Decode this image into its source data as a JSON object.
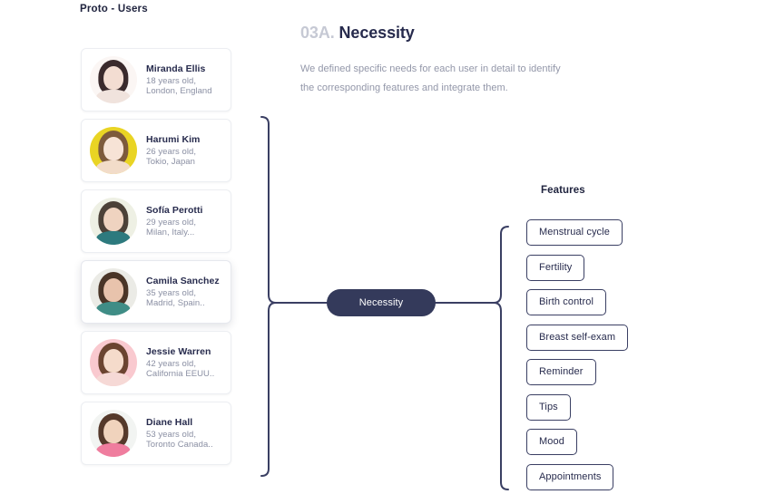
{
  "page": {
    "title": "Proto - Users"
  },
  "section": {
    "number": "03A.",
    "name": "Necessity",
    "description": "We defined specific needs for each user in detail to identify the corresponding features and integrate them."
  },
  "users": [
    {
      "name": "Miranda Ellis",
      "age": "18 years old,",
      "place": "London, England",
      "avatar_bg": "#fbf6f4",
      "hair": "#3a2a2c",
      "skin": "#f3ddd2",
      "body": "#f0e3dd",
      "elevated": false
    },
    {
      "name": "Harumi Kim",
      "age": "26 years old,",
      "place": "Tokio, Japan",
      "avatar_bg": "#e9d424",
      "hair": "#7d5a3c",
      "skin": "#f7e3d6",
      "body": "#f2dcc9",
      "elevated": false
    },
    {
      "name": "Sofía Perotti",
      "age": "29 years old,",
      "place": "Milan, Italy...",
      "avatar_bg": "#eef0e4",
      "hair": "#4c4138",
      "skin": "#efd3c0",
      "body": "#2d7a7e",
      "elevated": false
    },
    {
      "name": "Camila Sanchez",
      "age": "35 years old,",
      "place": "Madrid, Spain..",
      "avatar_bg": "#ebebe6",
      "hair": "#4a3527",
      "skin": "#e8c3ac",
      "body": "#3f8d86",
      "elevated": true
    },
    {
      "name": "Jessie Warren",
      "age": "42 years old,",
      "place": "California EEUU..",
      "avatar_bg": "#f9c9cf",
      "hair": "#6b4430",
      "skin": "#f5dbcb",
      "body": "#f6d9d6",
      "elevated": false
    },
    {
      "name": "Diane Hall",
      "age": "53 years old,",
      "place": "Toronto Canada..",
      "avatar_bg": "#f2f4f2",
      "hair": "#55392b",
      "skin": "#f0d3bd",
      "body": "#ef7d9e",
      "elevated": false
    }
  ],
  "diagram": {
    "center_node_label": "Necessity",
    "node_color": "#343a5b",
    "bracket_color": "#3a3f63"
  },
  "features": {
    "title": "Features",
    "items": [
      "Menstrual cycle",
      "Fertility",
      "Birth control",
      "Breast self-exam",
      "Reminder",
      "Tips",
      "Mood",
      "Appointments"
    ]
  }
}
